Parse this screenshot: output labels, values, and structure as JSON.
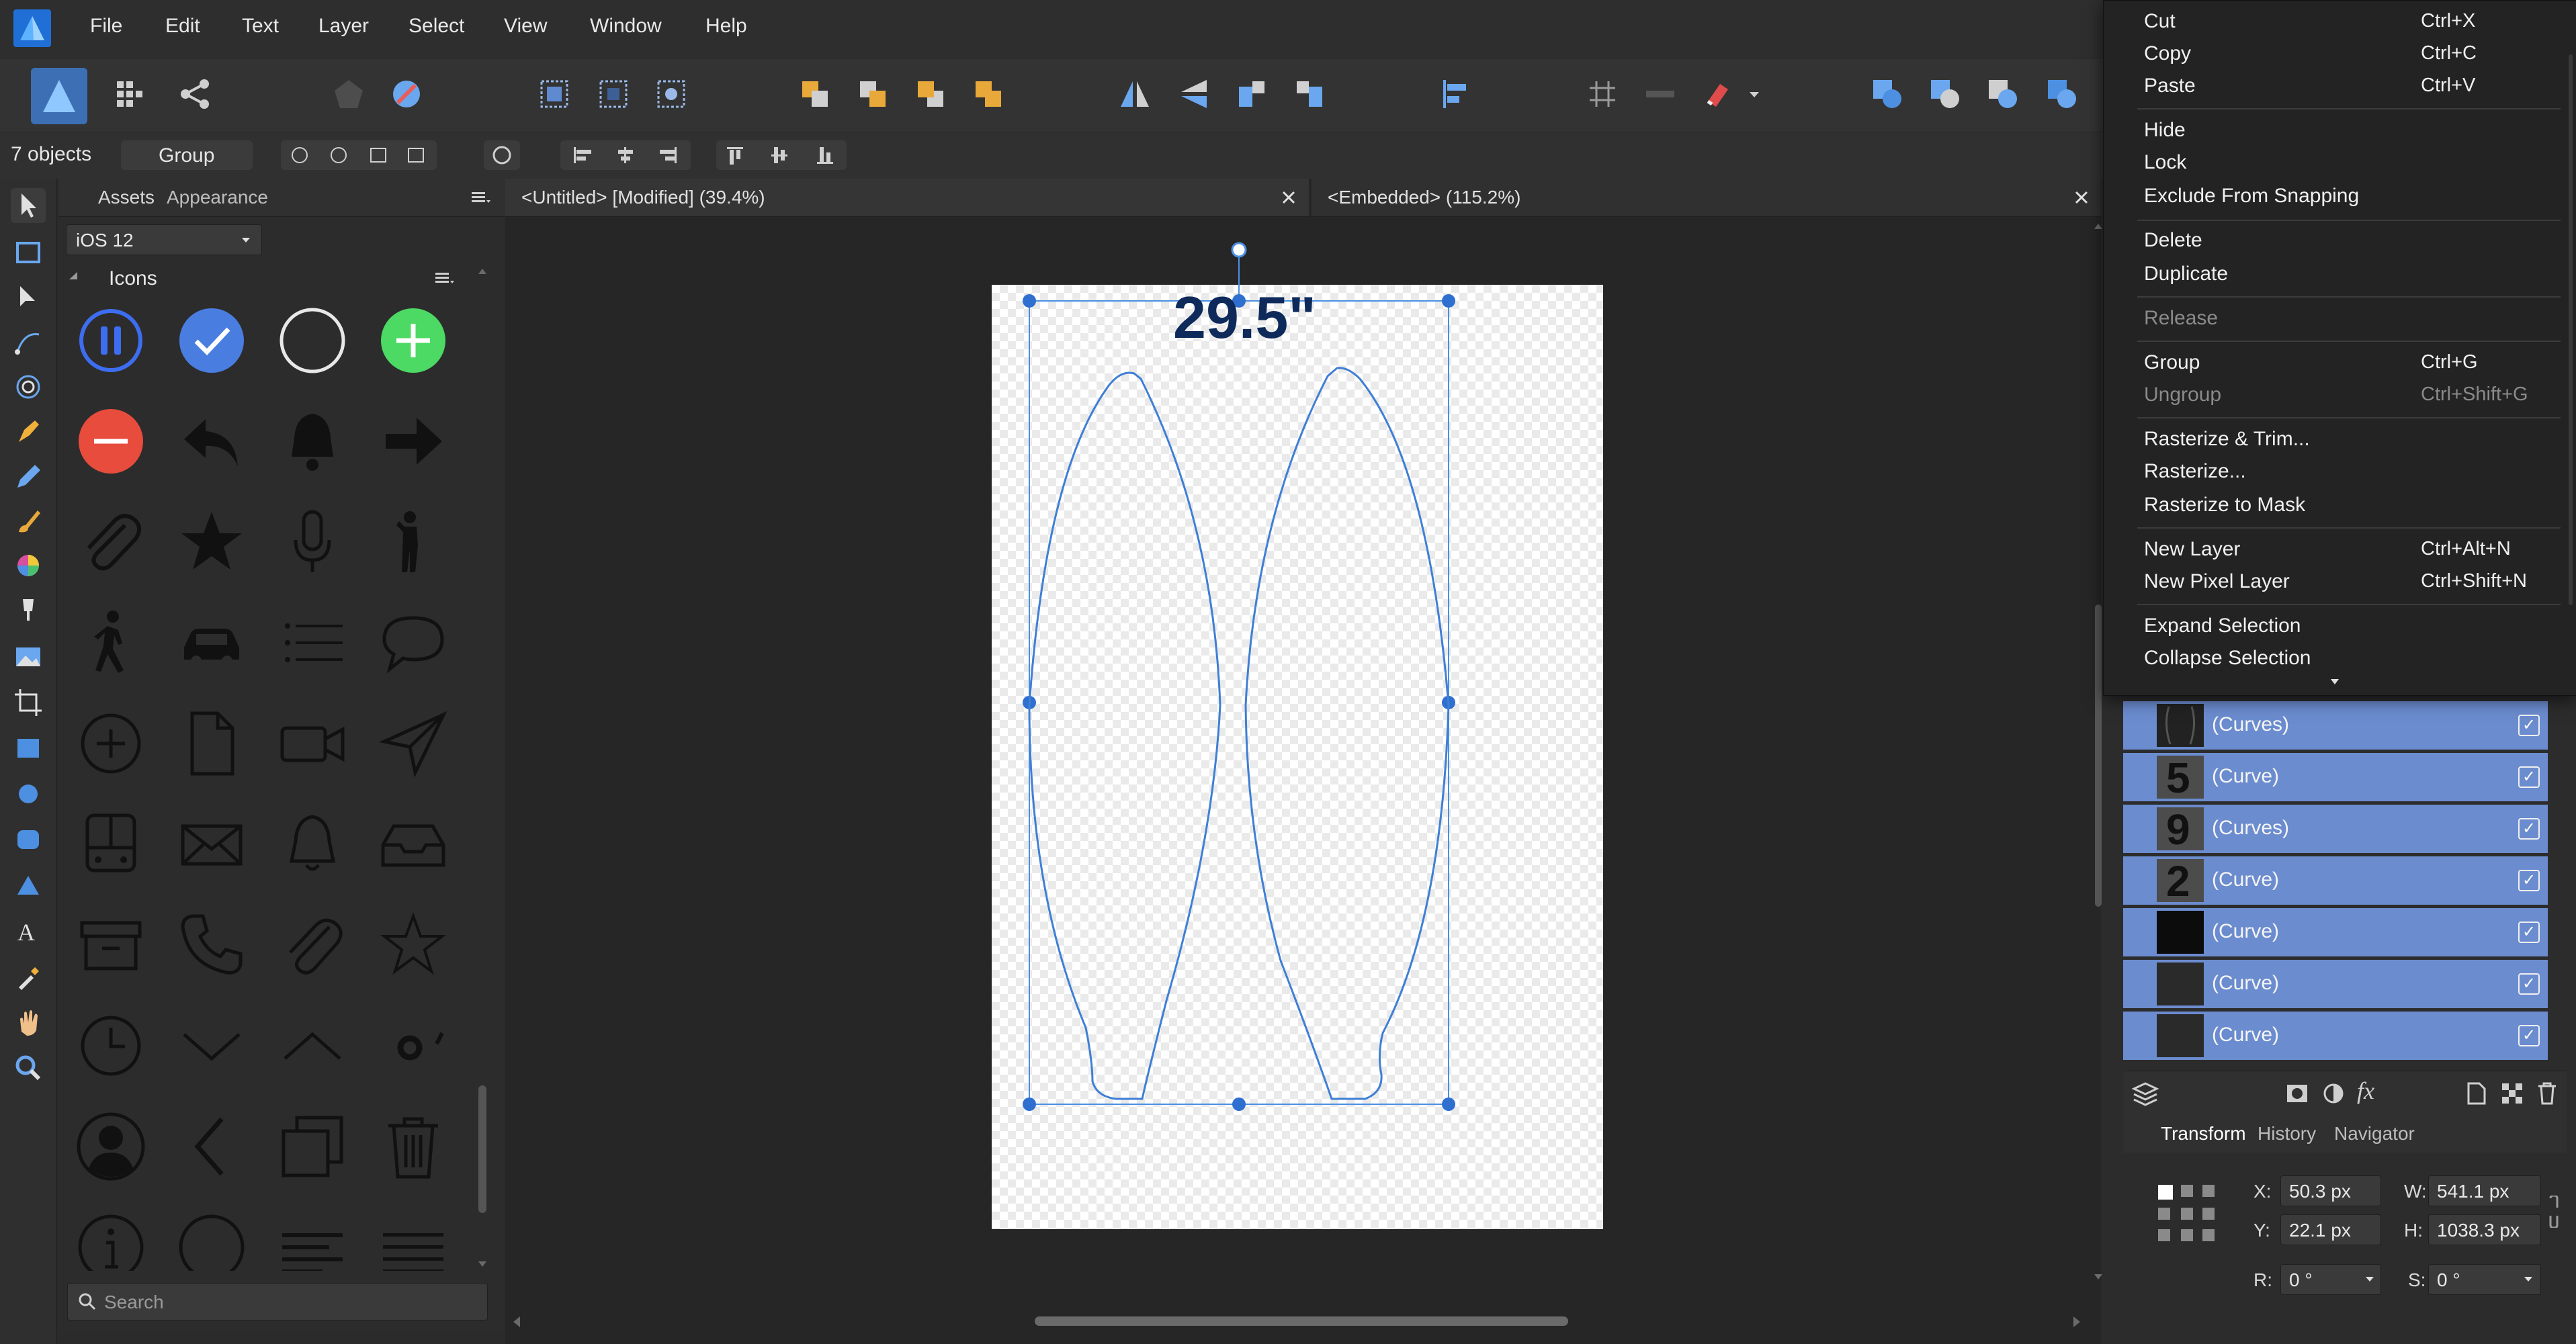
{
  "menubar": {
    "items": [
      "File",
      "Edit",
      "Text",
      "Layer",
      "Select",
      "View",
      "Window",
      "Help"
    ]
  },
  "context": {
    "selection_count": "7 objects",
    "group_button": "Group"
  },
  "assets_panel": {
    "tabs": [
      "Assets",
      "Appearance"
    ],
    "category_dropdown": "iOS 12",
    "section_title": "Icons",
    "search_placeholder": "Search",
    "icons": [
      "pause-circle-icon",
      "checkmark-circle-icon",
      "empty-circle-icon",
      "plus-circle-icon",
      "minus-circle-icon",
      "reply-icon",
      "bell-filled-icon",
      "arrow-right-icon",
      "paperclip-icon",
      "star-filled-icon",
      "microphone-icon",
      "person-standing-icon",
      "person-walking-icon",
      "car-icon",
      "list-icon",
      "speech-bubble-icon",
      "plus-circle-outline-icon",
      "document-icon",
      "video-camera-icon",
      "paper-plane-icon",
      "bus-icon",
      "envelope-icon",
      "bell-outline-icon",
      "inbox-tray-icon",
      "archive-box-icon",
      "phone-icon",
      "paperclip-outline-icon",
      "star-outline-icon",
      "clock-icon",
      "chevron-down-icon",
      "chevron-up-icon",
      "ring-icon",
      "person-silhouette-icon",
      "chevron-left-icon",
      "stacked-squares-icon",
      "trash-icon",
      "info-circle-icon",
      "circle-outline-icon",
      "text-align-left-icon",
      "text-align-justify-icon"
    ]
  },
  "documents": {
    "tab1": "<Untitled> [Modified] (39.4%)",
    "tab2": "<Embedded> (115.2%)",
    "artwork_label": "29.5\""
  },
  "context_menu": {
    "items": [
      {
        "label": "Cut",
        "shortcut": "Ctrl+X",
        "disabled": false
      },
      {
        "label": "Copy",
        "shortcut": "Ctrl+C",
        "disabled": false
      },
      {
        "label": "Paste",
        "shortcut": "Ctrl+V",
        "disabled": false
      },
      {
        "label": "Hide",
        "shortcut": "",
        "disabled": false
      },
      {
        "label": "Lock",
        "shortcut": "",
        "disabled": false
      },
      {
        "label": "Exclude From Snapping",
        "shortcut": "",
        "disabled": false
      },
      {
        "label": "Delete",
        "shortcut": "",
        "disabled": false
      },
      {
        "label": "Duplicate",
        "shortcut": "",
        "disabled": false
      },
      {
        "label": "Release",
        "shortcut": "",
        "disabled": true
      },
      {
        "label": "Group",
        "shortcut": "Ctrl+G",
        "disabled": false
      },
      {
        "label": "Ungroup",
        "shortcut": "Ctrl+Shift+G",
        "disabled": true
      },
      {
        "label": "Rasterize & Trim...",
        "shortcut": "",
        "disabled": false
      },
      {
        "label": "Rasterize...",
        "shortcut": "",
        "disabled": false
      },
      {
        "label": "Rasterize to Mask",
        "shortcut": "",
        "disabled": false
      },
      {
        "label": "New Layer",
        "shortcut": "Ctrl+Alt+N",
        "disabled": false
      },
      {
        "label": "New Pixel Layer",
        "shortcut": "Ctrl+Shift+N",
        "disabled": false
      },
      {
        "label": "Expand Selection",
        "shortcut": "",
        "disabled": false
      },
      {
        "label": "Collapse Selection",
        "shortcut": "",
        "disabled": false
      }
    ]
  },
  "layers": [
    {
      "name": "(Curves)",
      "thumb": ""
    },
    {
      "name": "(Curve)",
      "thumb": "5"
    },
    {
      "name": "(Curves)",
      "thumb": "9"
    },
    {
      "name": "(Curve)",
      "thumb": "2"
    },
    {
      "name": "(Curve)",
      "thumb": ""
    },
    {
      "name": "(Curve)",
      "thumb": ""
    },
    {
      "name": "(Curve)",
      "thumb": ""
    }
  ],
  "transform_panel": {
    "tabs": [
      "Transform",
      "History",
      "Navigator"
    ],
    "x_label": "X:",
    "x_value": "50.3 px",
    "y_label": "Y:",
    "y_value": "22.1 px",
    "w_label": "W:",
    "w_value": "541.1 px",
    "h_label": "H:",
    "h_value": "1038.3 px",
    "r_label": "R:",
    "r_value": "0 °",
    "s_label": "S:",
    "s_value": "0 °"
  },
  "colors": {
    "accent_blue": "#4a7de0",
    "layer_selected": "#6b8ccf",
    "affinity_logo": "#3b8fe8"
  }
}
